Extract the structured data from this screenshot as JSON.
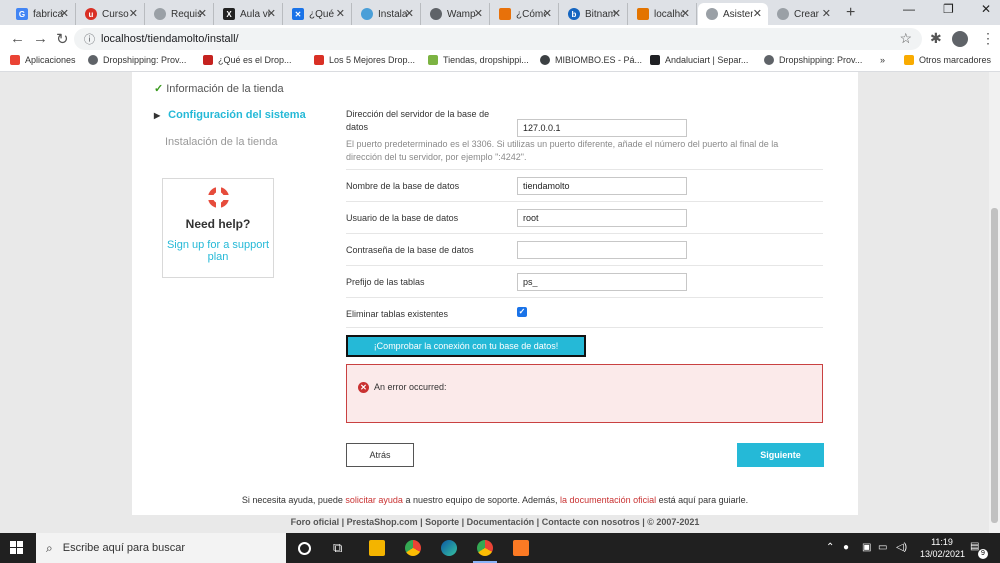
{
  "browser": {
    "tabs": [
      {
        "label": "fabricante de ventanas",
        "fav_color": "#4285f4",
        "fav_glyph": "G"
      },
      {
        "label": "Curso",
        "fav_color": "#d93025",
        "fav_glyph": "u"
      },
      {
        "label": "Requisitos",
        "fav_color": "#9aa0a6",
        "fav_glyph": ""
      },
      {
        "label": "Aula virtual",
        "fav_color": "#222222",
        "fav_glyph": "X"
      },
      {
        "label": "¿Qué",
        "fav_color": "#1a73e8",
        "fav_glyph": "✕"
      },
      {
        "label": "Instalación",
        "fav_color": "#4a9fd8",
        "fav_glyph": ""
      },
      {
        "label": "Wamp",
        "fav_color": "#5f6368",
        "fav_glyph": ""
      },
      {
        "label": "¿Cómo",
        "fav_color": "#e8710a",
        "fav_glyph": ""
      },
      {
        "label": "Bitnami",
        "fav_color": "#1565c0",
        "fav_glyph": "b"
      },
      {
        "label": "localhost",
        "fav_color": "#e37400",
        "fav_glyph": ""
      },
      {
        "label": "Asistente",
        "fav_color": "#9aa0a6",
        "fav_glyph": "",
        "active": true
      },
      {
        "label": "Crear",
        "fav_color": "#9aa0a6",
        "fav_glyph": ""
      }
    ],
    "new_tab_glyph": "+",
    "url": "localhost/tiendamolto/install/",
    "bookmarks": [
      {
        "label": "Aplicaciones",
        "color": "#ea4335"
      },
      {
        "label": "Dropshipping: Prov...",
        "color": "#5f6368"
      },
      {
        "label": "¿Qué es el Drop...",
        "color": "#c5221f"
      },
      {
        "label": "Los 5 Mejores Drop...",
        "color": "#d93025"
      },
      {
        "label": "Tiendas, dropshippi...",
        "color": "#7cb342"
      },
      {
        "label": "MIBIOMBO.ES - Pá...",
        "color": "#3c4043"
      },
      {
        "label": "Andaluciart | Separ...",
        "color": "#202124"
      },
      {
        "label": "Dropshipping: Prov...",
        "color": "#5f6368"
      }
    ],
    "more_bookmarks": "»",
    "other_bookmarks": "Otros marcadores"
  },
  "steps": {
    "done": "Información de la tienda",
    "current": "Configuración del sistema",
    "todo": "Instalación de la tienda"
  },
  "help": {
    "title": "Need help?",
    "link": "Sign up for a support plan"
  },
  "form": {
    "server_label": "Dirección del servidor de la base de datos",
    "server_value": "127.0.0.1",
    "server_hint": "El puerto predeterminado es el 3306. Si utilizas un puerto diferente, añade el número del puerto al final de la dirección del tu servidor, por ejemplo \":4242\".",
    "dbname_label": "Nombre de la base de datos",
    "dbname_value": "tiendamolto",
    "user_label": "Usuario de la base de datos",
    "user_value": "root",
    "password_label": "Contraseña de la base de datos",
    "password_value": "",
    "prefix_label": "Prefijo de las tablas",
    "prefix_value": "ps_",
    "drop_label": "Eliminar tablas existentes",
    "drop_checked": true
  },
  "check_button": "¡Comprobar la conexión con tu base de datos!",
  "error": {
    "text": "An error occurred:"
  },
  "buttons": {
    "back": "Atrás",
    "next": "Siguiente"
  },
  "help_line": {
    "part1": "Si necesita ayuda, puede ",
    "link1": "solicitar ayuda",
    "part2": " a nuestro equipo de soporte. Además, ",
    "link2": "la documentación oficial",
    "part3": " está aquí para guiarle."
  },
  "footer": "Foro oficial | PrestaShop.com | Soporte | Documentación | Contacte con nosotros | © 2007-2021",
  "taskbar": {
    "search_placeholder": "Escribe aquí para buscar",
    "time": "11:19",
    "date": "13/02/2021",
    "notifications": "9"
  },
  "colors": {
    "accent": "#25b9d7",
    "error": "#c93232",
    "success": "#3a9a1e"
  }
}
